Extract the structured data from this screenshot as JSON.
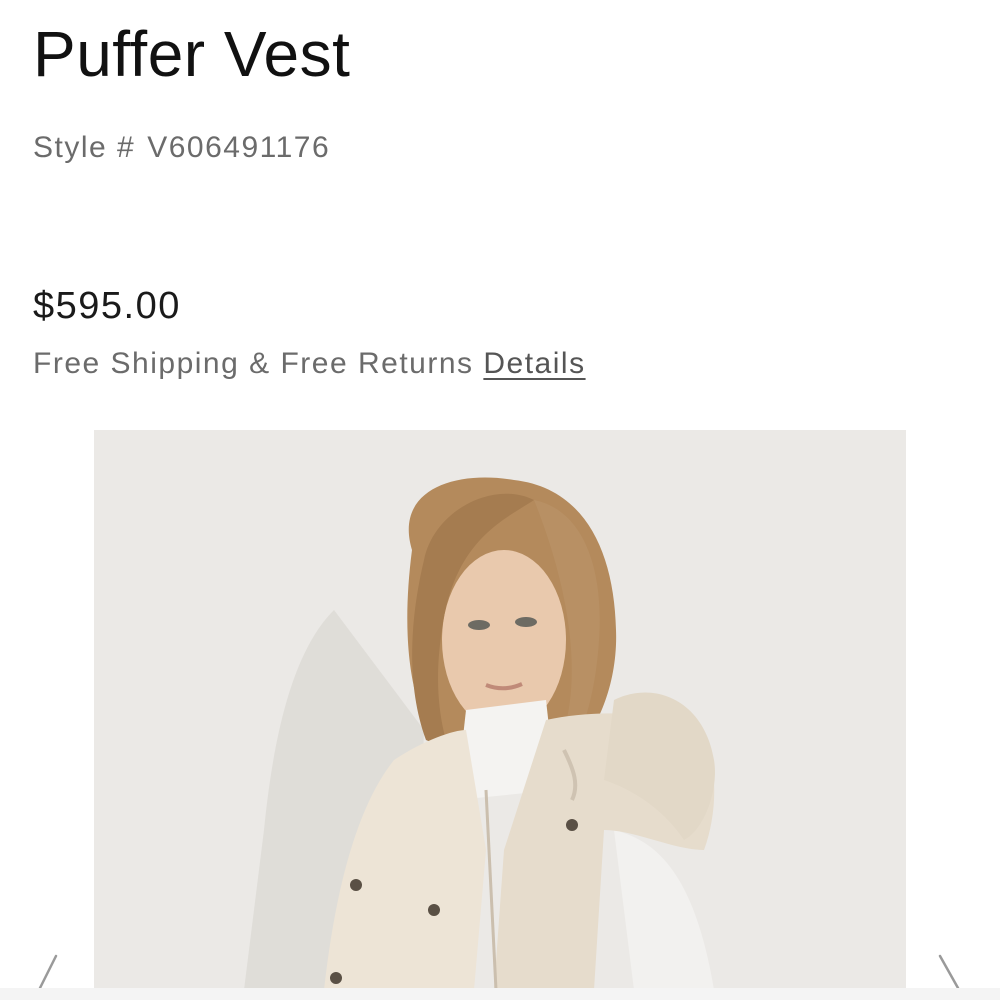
{
  "product": {
    "title": "Puffer Vest",
    "style_label": "Style #",
    "style_number": "V606491176",
    "price": "$595.00",
    "shipping_text": "Free Shipping & Free Returns",
    "details_link": "Details"
  },
  "gallery": {
    "prev_icon": "chevron-left-icon",
    "next_icon": "chevron-right-icon"
  },
  "colors": {
    "background": "#ffffff",
    "image_backdrop": "#ebe9e6",
    "vest": "#ede4d6",
    "secondary_text": "#6b6b6b"
  }
}
